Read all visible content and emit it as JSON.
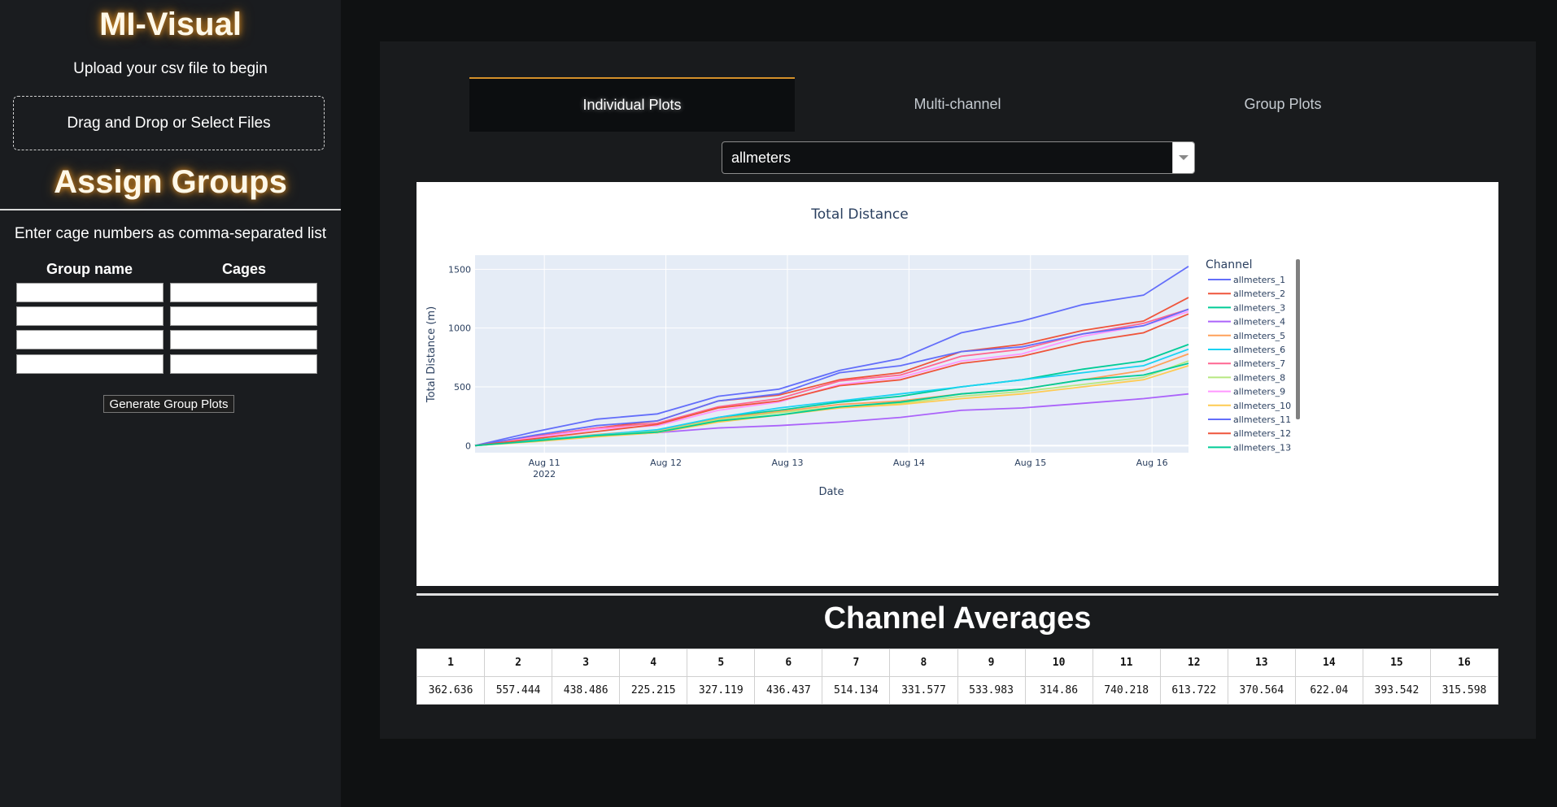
{
  "sidebar": {
    "app_title": "MI-Visual",
    "upload_text": "Upload your csv file to begin",
    "dropzone_label": "Drag and Drop or Select Files",
    "assign_title": "Assign Groups",
    "instructions": "Enter cage numbers as comma-separated list",
    "group_name_header": "Group name",
    "cages_header": "Cages",
    "generate_button": "Generate Group Plots"
  },
  "main": {
    "tabs": [
      {
        "label": "Individual Plots",
        "active": true
      },
      {
        "label": "Multi-channel",
        "active": false
      },
      {
        "label": "Group Plots",
        "active": false
      }
    ],
    "dropdown_value": "allmeters",
    "averages_title": "Channel Averages",
    "averages_table": {
      "headers": [
        "1",
        "2",
        "3",
        "4",
        "5",
        "6",
        "7",
        "8",
        "9",
        "10",
        "11",
        "12",
        "13",
        "14",
        "15",
        "16"
      ],
      "values": [
        "362.636",
        "557.444",
        "438.486",
        "225.215",
        "327.119",
        "436.437",
        "514.134",
        "331.577",
        "533.983",
        "314.86",
        "740.218",
        "613.722",
        "370.564",
        "622.04",
        "393.542",
        "315.598"
      ]
    }
  },
  "chart_data": {
    "type": "line",
    "title": "Total Distance",
    "xlabel": "Date",
    "ylabel": "Total Distance (m)",
    "x_ticks": [
      "Aug 11 2022",
      "Aug 12",
      "Aug 13",
      "Aug 14",
      "Aug 15",
      "Aug 16"
    ],
    "y_ticks": [
      0,
      500,
      1000,
      1500
    ],
    "ylim": [
      -60,
      1620
    ],
    "xlim": [
      0,
      5.87
    ],
    "x": [
      0,
      0.5,
      1.0,
      1.5,
      2.0,
      2.5,
      3.0,
      3.5,
      4.0,
      4.5,
      5.0,
      5.5,
      5.87
    ],
    "legend_title": "Channel",
    "legend_position": "right",
    "series": [
      {
        "name": "allmeters_1",
        "color": "#636efa",
        "values": [
          0,
          120,
          225,
          270,
          420,
          480,
          640,
          740,
          960,
          1060,
          1200,
          1280,
          1525
        ]
      },
      {
        "name": "allmeters_2",
        "color": "#EF553B",
        "values": [
          0,
          80,
          150,
          210,
          380,
          430,
          560,
          620,
          800,
          860,
          980,
          1060,
          1260
        ]
      },
      {
        "name": "allmeters_3",
        "color": "#00cc96",
        "values": [
          0,
          50,
          90,
          130,
          240,
          300,
          370,
          420,
          500,
          560,
          650,
          720,
          860
        ]
      },
      {
        "name": "allmeters_4",
        "color": "#ab63fa",
        "values": [
          0,
          40,
          80,
          110,
          150,
          170,
          200,
          240,
          300,
          320,
          360,
          400,
          440
        ]
      },
      {
        "name": "allmeters_5",
        "color": "#FFA15A",
        "values": [
          0,
          45,
          95,
          130,
          230,
          290,
          350,
          380,
          440,
          480,
          560,
          640,
          780
        ]
      },
      {
        "name": "allmeters_6",
        "color": "#19d3f3",
        "values": [
          0,
          45,
          90,
          135,
          240,
          320,
          380,
          440,
          500,
          560,
          620,
          680,
          820
        ]
      },
      {
        "name": "allmeters_7",
        "color": "#FF6692",
        "values": [
          0,
          80,
          150,
          190,
          330,
          400,
          550,
          600,
          760,
          820,
          950,
          1040,
          1160
        ]
      },
      {
        "name": "allmeters_8",
        "color": "#B6E880",
        "values": [
          0,
          40,
          85,
          120,
          220,
          280,
          330,
          360,
          420,
          460,
          520,
          580,
          720
        ]
      },
      {
        "name": "allmeters_9",
        "color": "#FF97FF",
        "values": [
          0,
          70,
          140,
          170,
          300,
          370,
          520,
          580,
          720,
          780,
          930,
          1020,
          1140
        ]
      },
      {
        "name": "allmeters_10",
        "color": "#FECB52",
        "values": [
          0,
          35,
          75,
          110,
          200,
          260,
          320,
          350,
          400,
          440,
          500,
          560,
          680
        ]
      },
      {
        "name": "allmeters_11",
        "color": "#636efa",
        "values": [
          0,
          90,
          170,
          210,
          380,
          440,
          620,
          680,
          800,
          840,
          950,
          1020,
          1160
        ]
      },
      {
        "name": "allmeters_12",
        "color": "#EF553B",
        "values": [
          0,
          60,
          120,
          180,
          320,
          380,
          510,
          560,
          700,
          760,
          880,
          960,
          1120
        ]
      },
      {
        "name": "allmeters_13",
        "color": "#00cc96",
        "values": [
          0,
          40,
          85,
          115,
          210,
          260,
          330,
          370,
          440,
          480,
          560,
          600,
          700
        ]
      }
    ]
  }
}
